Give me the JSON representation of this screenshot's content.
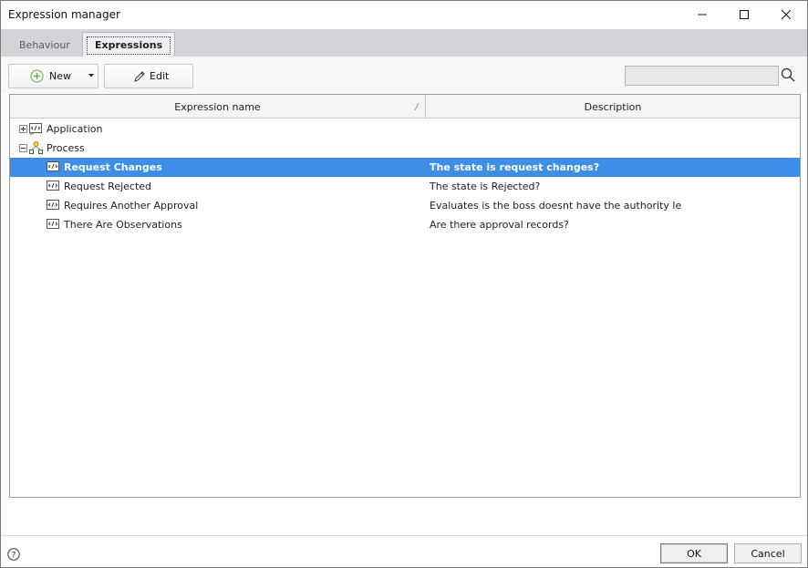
{
  "window": {
    "title": "Expression manager"
  },
  "tabs": [
    {
      "label": "Behaviour"
    },
    {
      "label": "Expressions"
    }
  ],
  "toolbar": {
    "new_label": "New",
    "edit_label": "Edit",
    "search_value": ""
  },
  "grid": {
    "columns": [
      "Expression name",
      "Description"
    ],
    "rows": [
      {
        "name": "Application",
        "description": "",
        "level": 0,
        "expandable": "plus",
        "icon": "expression-group-icon"
      },
      {
        "name": "Process",
        "description": "",
        "level": 0,
        "expandable": "minus",
        "icon": "process-icon"
      },
      {
        "name": "Request Changes",
        "description": "The state is request changes?",
        "level": 1,
        "selected": true,
        "icon": "expression-icon"
      },
      {
        "name": "Request Rejected",
        "description": "The state is Rejected?",
        "level": 1,
        "icon": "expression-icon"
      },
      {
        "name": "Requires Another Approval",
        "description": "Evaluates is the boss doesnt have the authority le",
        "level": 1,
        "icon": "expression-icon"
      },
      {
        "name": "There Are Observations",
        "description": "Are there approval records?",
        "level": 1,
        "icon": "expression-icon"
      }
    ]
  },
  "footer": {
    "ok_label": "OK",
    "cancel_label": "Cancel"
  },
  "colors": {
    "selection": "#3d8ee9",
    "tabstrip": "#d2d4d8",
    "accent_green": "#6aa84f"
  }
}
